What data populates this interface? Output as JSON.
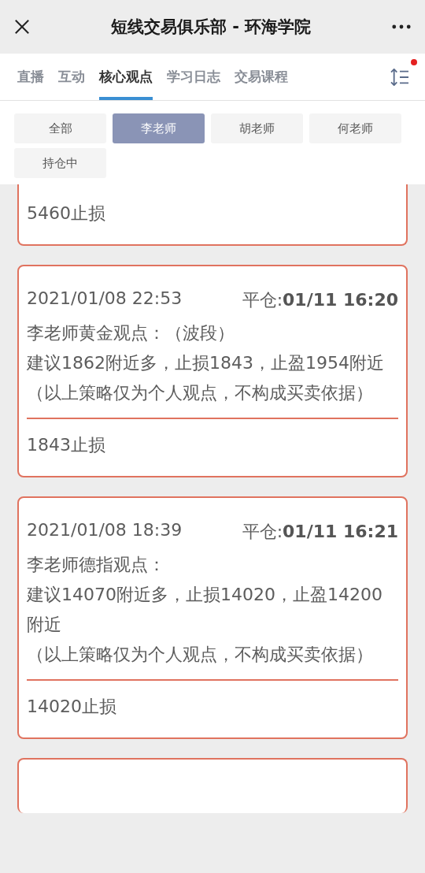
{
  "window": {
    "title": "短线交易俱乐部 - 环海学院"
  },
  "tabs": [
    {
      "label": "直播",
      "selected": false
    },
    {
      "label": "互动",
      "selected": false
    },
    {
      "label": "核心观点",
      "selected": true
    },
    {
      "label": "学习日志",
      "selected": false
    },
    {
      "label": "交易课程",
      "selected": false
    }
  ],
  "sort_menu": {
    "unread": true
  },
  "filters": [
    {
      "label": "全部",
      "selected": false
    },
    {
      "label": "李老师",
      "selected": true
    },
    {
      "label": "胡老师",
      "selected": false
    },
    {
      "label": "何老师",
      "selected": false
    },
    {
      "label": "持仓中",
      "selected": false
    }
  ],
  "posts": [
    {
      "kind": "partial",
      "result": "5460止损"
    },
    {
      "kind": "full",
      "time": "2021/01/08 22:53",
      "closed": "平仓:**01/11 16:20**",
      "lines": [
        "李老师黄金观点：（波段）",
        "建议1862附近多，止损1843，止盈1954附近",
        "（以上策略仅为个人观点，不构成买卖依据）"
      ],
      "result": "1843止损"
    },
    {
      "kind": "full",
      "time": "2021/01/08 18:39",
      "closed": "平仓:**01/11 16:21**",
      "lines": [
        "李老师德指观点：",
        "建议14070附近多，止损14020，止盈14200附近",
        "（以上策略仅为个人观点，不构成买卖依据）"
      ],
      "result": "14020止损"
    },
    {
      "kind": "empty"
    }
  ]
}
